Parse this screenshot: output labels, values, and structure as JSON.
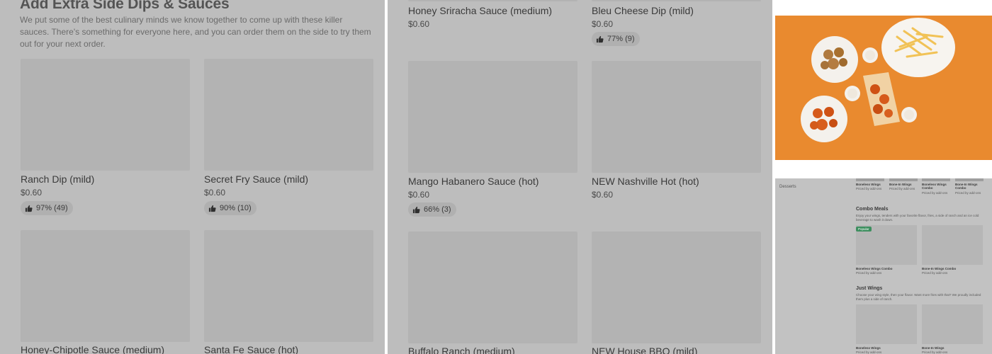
{
  "left_panel": {
    "title": "Add Extra Side Dips & Sauces",
    "description": "We put some of the best culinary minds we know together to come up with these killer sauces. There's something for everyone here, and you can order them on the side to try them out for your next order.",
    "items": [
      {
        "name": "Ranch Dip (mild)",
        "price": "$0.60",
        "rating": "97% (49)"
      },
      {
        "name": "Secret Fry Sauce (mild)",
        "price": "$0.60",
        "rating": "90% (10)"
      },
      {
        "name": "Honey-Chipotle Sauce (medium)"
      },
      {
        "name": "Santa Fe Sauce (hot)"
      }
    ]
  },
  "middle_panel": {
    "items": [
      {
        "name": "Honey Sriracha Sauce (medium)",
        "price": "$0.60"
      },
      {
        "name": "Bleu Cheese Dip (mild)",
        "price": "$0.60",
        "rating": "77% (9)"
      },
      {
        "name": "Mango Habanero Sauce (hot)",
        "price": "$0.60",
        "rating": "66% (3)"
      },
      {
        "name": "NEW Nashville Hot (hot)",
        "price": "$0.60"
      },
      {
        "name": "Buffalo Ranch (medium)"
      },
      {
        "name": "NEW House BBQ (mild)"
      }
    ]
  },
  "right_panel": {
    "sidebar_item": "Desserts",
    "top_row": [
      {
        "name": "Boneless Wings",
        "sub": "Priced by add-ons"
      },
      {
        "name": "Bone-In Wings",
        "sub": "Priced by add-ons"
      },
      {
        "name": "Boneless Wings Combo",
        "sub": "Priced by add-ons"
      },
      {
        "name": "Bone-In Wings Combo",
        "sub": "Priced by add-ons"
      }
    ],
    "combo": {
      "title": "Combo Meals",
      "desc": "Enjoy your wings, tenders with your favorite flavor, fries, a side of ranch and an ice cold beverage to wash it down.",
      "badge": "Popular",
      "items": [
        {
          "name": "Boneless Wings Combo",
          "sub": "Priced by add-ons"
        },
        {
          "name": "Bone-In Wings Combo",
          "sub": "Priced by add-ons"
        }
      ]
    },
    "just_wings": {
      "title": "Just Wings",
      "desc": "Choose your wing style, then your flavor. Want more fries with that? We proudly included them plus a side of ranch.",
      "items": [
        {
          "name": "Boneless Wings",
          "sub": "Priced by add-ons"
        },
        {
          "name": "Bone-In Wings",
          "sub": "Priced by add-ons"
        }
      ]
    }
  },
  "colors": {
    "overlay": "#bdbdbd",
    "card": "#b3b3b3",
    "hero_bg": "#e98a2f",
    "popular_badge": "#3d8f5f"
  }
}
